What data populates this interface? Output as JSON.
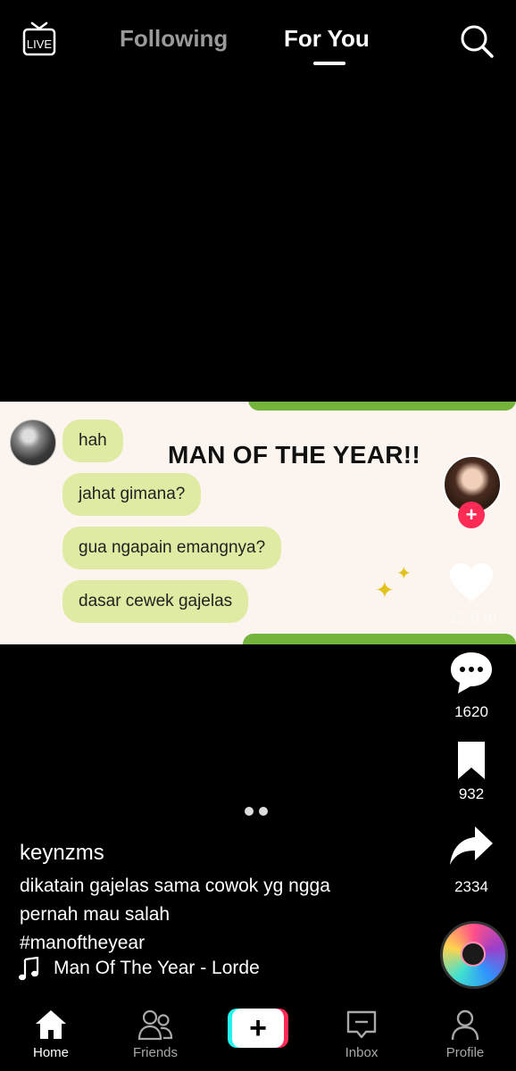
{
  "header": {
    "live_label": "LIVE",
    "tabs": [
      {
        "label": "Following",
        "active": false
      },
      {
        "label": "For You",
        "active": true
      }
    ]
  },
  "video": {
    "title": "MAN OF THE YEAR!!",
    "chat_bubbles": [
      "hah",
      "jahat gimana?",
      "gua ngapain emangnya?",
      "dasar cewek gajelas"
    ]
  },
  "actions": {
    "like_count": "12,6 rb",
    "comment_count": "1620",
    "bookmark_count": "932",
    "share_count": "2334",
    "follow_symbol": "+"
  },
  "post": {
    "username": "keynzms",
    "caption_lines": [
      "dikatain gajelas sama cowok yg ngga",
      "pernah mau salah",
      "#manoftheyear"
    ],
    "music": "Man Of The Year - Lorde"
  },
  "pager": {
    "dots": 2
  },
  "nav": [
    {
      "label": "Home",
      "active": true
    },
    {
      "label": "Friends",
      "active": false
    },
    {
      "label": "+",
      "active": false
    },
    {
      "label": "Inbox",
      "active": false
    },
    {
      "label": "Profile",
      "active": false
    }
  ],
  "colors": {
    "accent": "#fe2c55",
    "cyan": "#25f4ee",
    "bubble": "#dfeaa2",
    "video_green": "#74b33c",
    "inactive_tab": "#9a9a9a"
  }
}
